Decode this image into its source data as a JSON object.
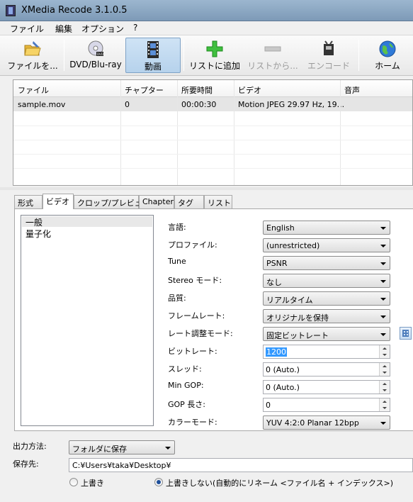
{
  "window": {
    "title": "XMedia Recode 3.1.0.5"
  },
  "menu": [
    "ファイル",
    "編集",
    "オプション",
    "?"
  ],
  "toolbar": {
    "open_file": "ファイルを...",
    "dvd_bluray": "DVD/Blu-ray",
    "video": "動画",
    "add_to_list": "リストに追加",
    "remove_from_list": "リストから...",
    "encode": "エンコード",
    "home": "ホーム"
  },
  "filelist": {
    "columns": [
      "ファイル",
      "チャプター",
      "所要時間",
      "ビデオ",
      "音声"
    ],
    "rows": [
      {
        "file": "sample.mov",
        "chapter": "0",
        "duration": "00:00:30",
        "video": "Motion JPEG 29.97 Hz, 19...",
        "audio": ""
      }
    ]
  },
  "tabs": [
    "形式",
    "ビデオ",
    "クロップ/プレビュー",
    "Chapter",
    "タグ",
    "リスト"
  ],
  "video_settings": {
    "sublist": [
      "一般",
      "量子化"
    ],
    "fields": [
      {
        "label": "言語:",
        "value": "English"
      },
      {
        "label": "プロファイル:",
        "value": "(unrestricted)"
      },
      {
        "label": "Tune",
        "value": "PSNR"
      },
      {
        "label": "Stereo モード:",
        "value": "なし"
      },
      {
        "label": "品質:",
        "value": "リアルタイム"
      },
      {
        "label": "フレームレート:",
        "value": "オリジナルを保持"
      },
      {
        "label": "レート調整モード:",
        "value": "固定ビットレート"
      },
      {
        "label": "ビットレート:",
        "value": "1200"
      },
      {
        "label": "スレッド:",
        "value": "0 (Auto.)"
      },
      {
        "label": "Min GOP:",
        "value": "0 (Auto.)"
      },
      {
        "label": "GOP 長さ:",
        "value": "0"
      },
      {
        "label": "カラーモード:",
        "value": "YUV 4:2:0 Planar 12bpp"
      }
    ]
  },
  "output": {
    "method_label": "出力方法:",
    "method_value": "フォルダに保存",
    "save_label": "保存先:",
    "save_path": "C:¥Users¥taka¥Desktop¥",
    "overwrite": "上書き",
    "no_overwrite": "上書きしない(自動的にリネーム <ファイル名 + インデックス>)"
  },
  "colors": {
    "accent": "#3399ff",
    "title_bar": "#8ea9c4"
  },
  "icons": [
    "app-icon",
    "folder-open-icon",
    "dvd-icon",
    "film-icon",
    "plus-icon",
    "minus-icon",
    "encode-icon",
    "globe-icon",
    "grid-icon"
  ]
}
